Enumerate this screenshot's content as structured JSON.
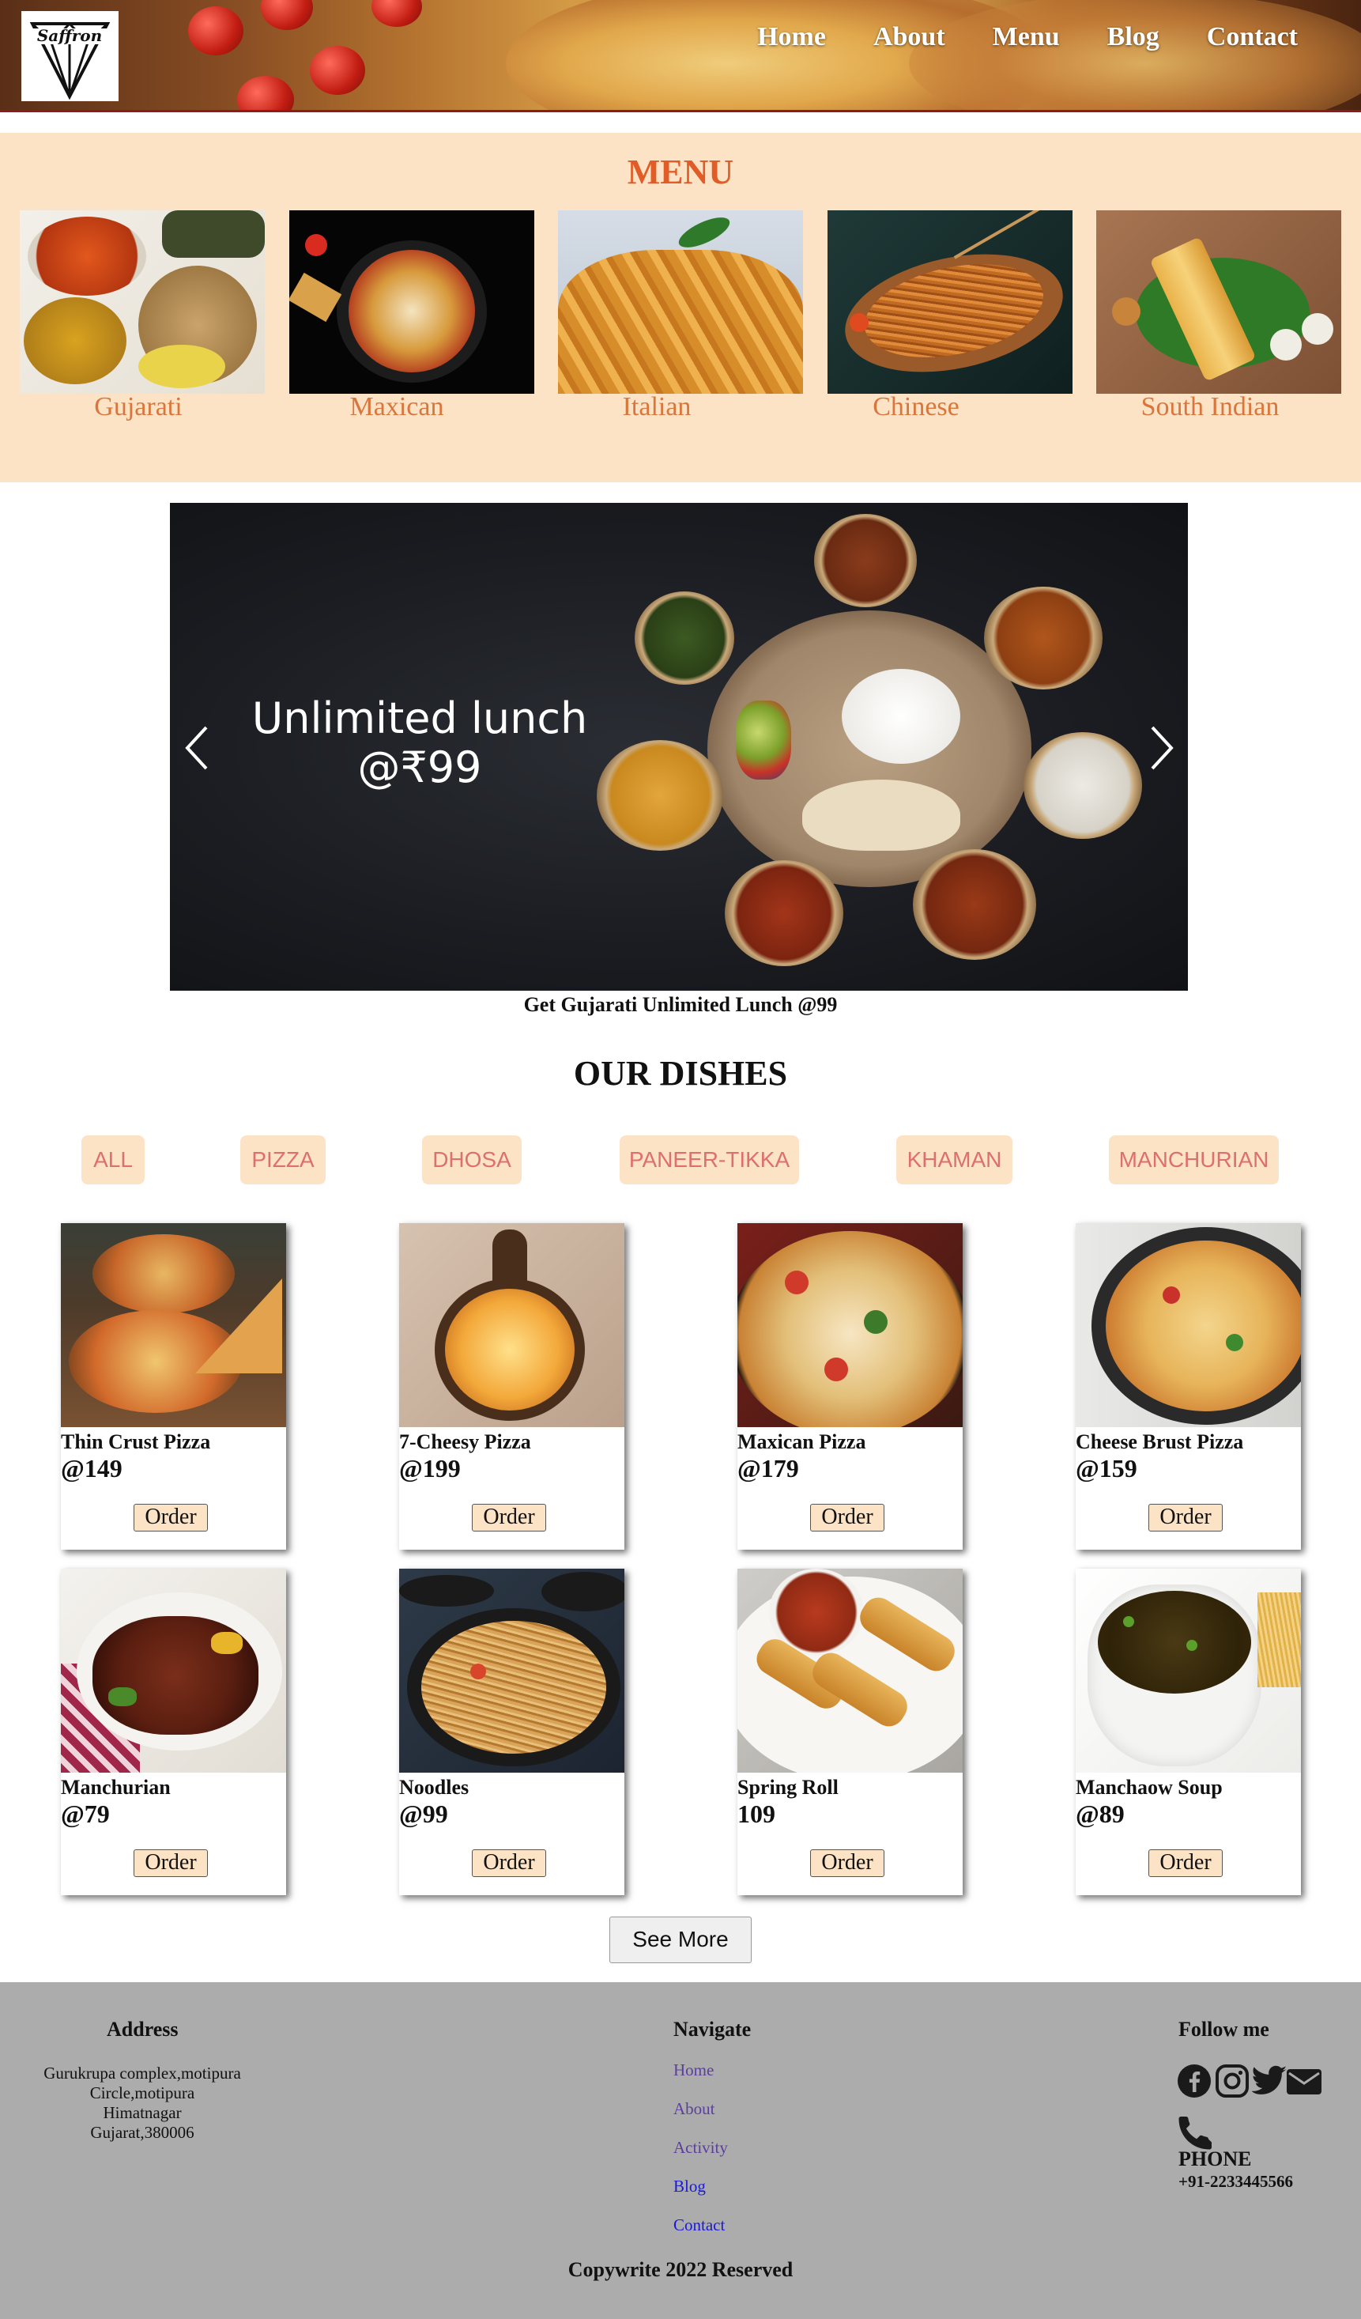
{
  "header": {
    "logo_text": "Saffron",
    "nav": [
      "Home",
      "About",
      "Menu",
      "Blog",
      "Contact"
    ]
  },
  "menu": {
    "title": "MENU",
    "cuisines": [
      "Gujarati",
      "Maxican",
      "Italian",
      "Chinese",
      "South Indian"
    ]
  },
  "banner": {
    "line1": "Unlimited lunch",
    "line2": "@₹99",
    "caption": "Get Gujarati Unlimited Lunch @99"
  },
  "dishes": {
    "title": "OUR DISHES",
    "filters": [
      "ALL",
      "PIZZA",
      "DHOSA",
      "PANEER-TIKKA",
      "KHAMAN",
      "MANCHURIAN"
    ],
    "items": [
      {
        "name": "Thin Crust Pizza",
        "price": "@149",
        "order": "Order"
      },
      {
        "name": "7-Cheesy Pizza",
        "price": "@199",
        "order": "Order"
      },
      {
        "name": "Maxican Pizza",
        "price": "@179",
        "order": "Order"
      },
      {
        "name": "Cheese Brust Pizza",
        "price": "@159",
        "order": "Order"
      },
      {
        "name": "Manchurian",
        "price": "@79",
        "order": "Order"
      },
      {
        "name": "Noodles",
        "price": "@99",
        "order": "Order"
      },
      {
        "name": "Spring Roll",
        "price": "109",
        "order": "Order"
      },
      {
        "name": "Manchaow Soup",
        "price": "@89",
        "order": "Order"
      }
    ],
    "see_more": "See More"
  },
  "footer": {
    "address_title": "Address",
    "address_lines": [
      "Gurukrupa complex,motipura",
      "Circle,motipura",
      "Himatnagar",
      "Gujarat,380006"
    ],
    "navigate_title": "Navigate",
    "links": [
      {
        "label": "Home",
        "color": "#5b3ea0"
      },
      {
        "label": "About",
        "color": "#5b3ea0"
      },
      {
        "label": "Activity",
        "color": "#5b3ea0"
      },
      {
        "label": "Blog",
        "color": "#1a1ad6"
      },
      {
        "label": "Contact",
        "color": "#1a1ad6"
      }
    ],
    "follow_title": "Follow me",
    "social_icons": [
      "facebook-icon",
      "instagram-icon",
      "twitter-icon",
      "mail-icon"
    ],
    "phone_label": "PHONE",
    "phone_number": "+91-2233445566",
    "copyright": "Copywrite 2022 Reserved"
  },
  "colors": {
    "accent_orange": "#e15c26",
    "peach_bg": "#fde3c6",
    "footer_bg": "#acacac",
    "header_border": "#8c1c1c"
  }
}
